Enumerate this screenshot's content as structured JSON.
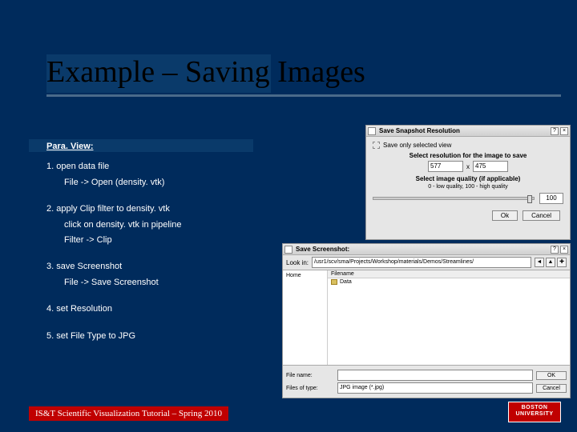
{
  "slide": {
    "title": "Example – Saving Images",
    "section": "Para. View:",
    "steps": [
      {
        "text": "1. open data file",
        "subs": [
          "File -> Open (density. vtk)"
        ]
      },
      {
        "text": "2. apply Clip filter to density. vtk",
        "subs": [
          "click on density. vtk in pipeline",
          "Filter -> Clip"
        ]
      },
      {
        "text": "3. save Screenshot",
        "subs": [
          "File -> Save Screenshot"
        ]
      },
      {
        "text": "4. set Resolution",
        "subs": []
      },
      {
        "text": "5. set File Type to JPG",
        "subs": []
      }
    ],
    "footer": "IS&T Scientific Visualization Tutorial – Spring 2010",
    "logo_line1": "BOSTON",
    "logo_line2": "UNIVERSITY"
  },
  "dialog_resolution": {
    "title": "Save Snapshot Resolution",
    "checkbox": "Save only selected view",
    "reslabel": "Select resolution for the image to save",
    "w": "577",
    "x": "x",
    "h": "475",
    "quallabel": "Select image quality (if applicable)",
    "qualhint": "0 - low quality, 100 - high quality",
    "qualval": "100",
    "ok": "Ok",
    "cancel": "Cancel"
  },
  "dialog_save": {
    "title": "Save Screenshot:",
    "lookin": "Look in:",
    "path": "/usr1/scv/sma/Projects/Workshop/materials/Demos/Streamlines/",
    "fav": "Home",
    "filehead": "Filename",
    "folder": "Data",
    "filename_label": "File name:",
    "filename_value": "",
    "type_label": "Files of type:",
    "type_value": "JPG image (*.jpg)",
    "ok": "OK",
    "cancel": "Cancel"
  }
}
